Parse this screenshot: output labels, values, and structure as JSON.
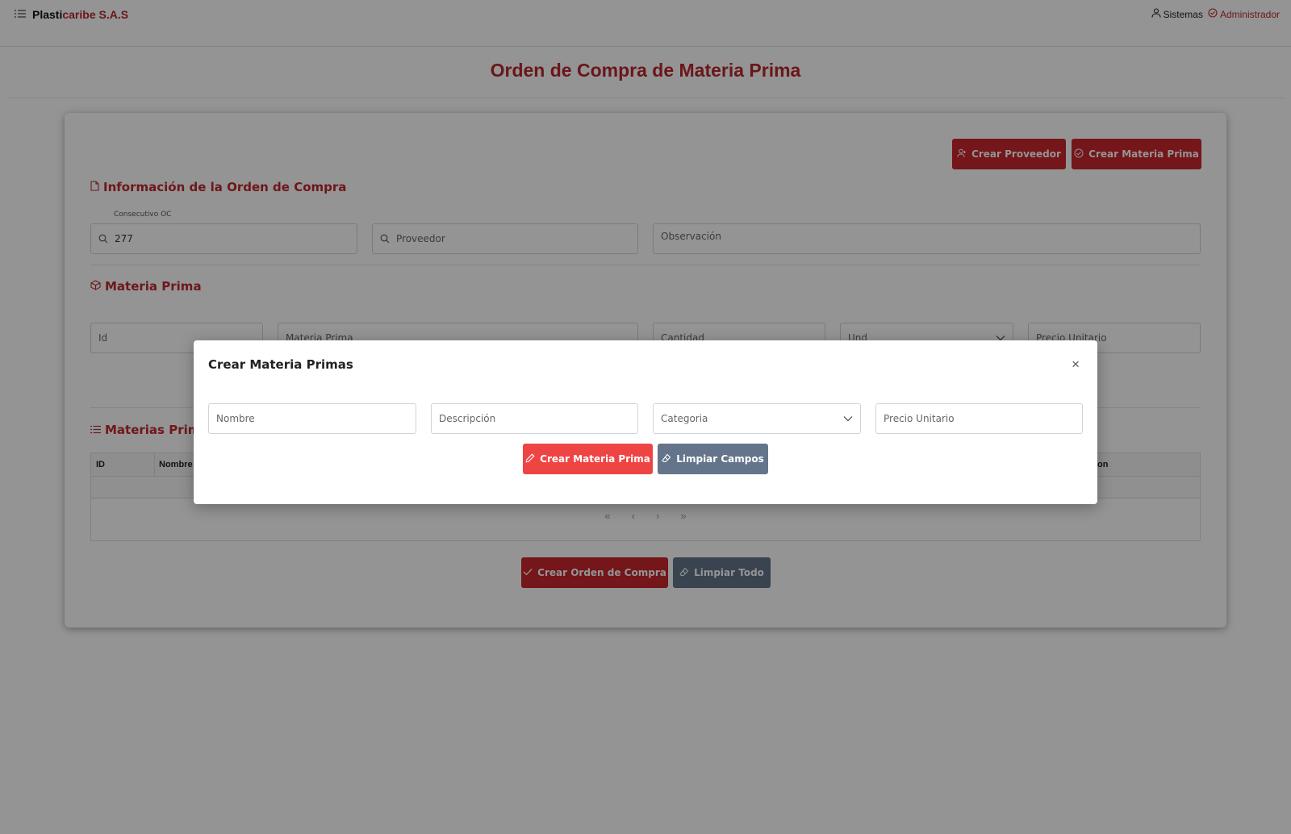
{
  "header": {
    "brand_part1": "Plasti",
    "brand_part2": "caribe S.A.S",
    "sistemas": "Sistemas",
    "user": "Administrador"
  },
  "page_title": "Orden de Compra de Materia Prima",
  "actions": {
    "crear_proveedor": "Crear Proveedor",
    "crear_materia_prima": "Crear Materia Prima"
  },
  "orden": {
    "heading": "Información de la Orden de Compra",
    "consecutivo_label": "Consecutivo OC",
    "consecutivo_value": "277",
    "proveedor_placeholder": "Proveedor",
    "observacion_placeholder": "Observación"
  },
  "materia": {
    "heading": "Materia Prima",
    "id_placeholder": "Id",
    "materia_placeholder": "Materia Prima",
    "cantidad_placeholder": "Cantidad",
    "und_placeholder": "Und",
    "precio_placeholder": "Precio Unitario"
  },
  "tabla": {
    "heading": "Materias Primas",
    "columns": [
      "ID",
      "Nombre",
      "on"
    ],
    "pager": [
      "«",
      "‹",
      "›",
      "»"
    ]
  },
  "bottom": {
    "crear_orden": "Crear Orden de Compra",
    "limpiar_todo": "Limpiar Todo"
  },
  "modal": {
    "title": "Crear Materia Primas",
    "close": "×",
    "nombre_placeholder": "Nombre",
    "descripcion_placeholder": "Descripción",
    "categoria_placeholder": "Categoria",
    "precio_placeholder": "Precio Unitario",
    "crear_button": "Crear Materia Prima",
    "limpiar_button": "Limpiar Campos"
  },
  "colors": {
    "brand_red": "#b8262e",
    "button_red": "#c8262e",
    "button_bright_red": "#ef4444",
    "button_slate": "#64748b"
  },
  "icons": [
    "menu-icon",
    "user-icon",
    "check-circle-icon",
    "user-plus-icon",
    "file-icon",
    "search-icon",
    "box-icon",
    "list-icon",
    "chevron-down-icon",
    "pencil-icon",
    "eraser-icon",
    "check-icon",
    "close-icon"
  ]
}
